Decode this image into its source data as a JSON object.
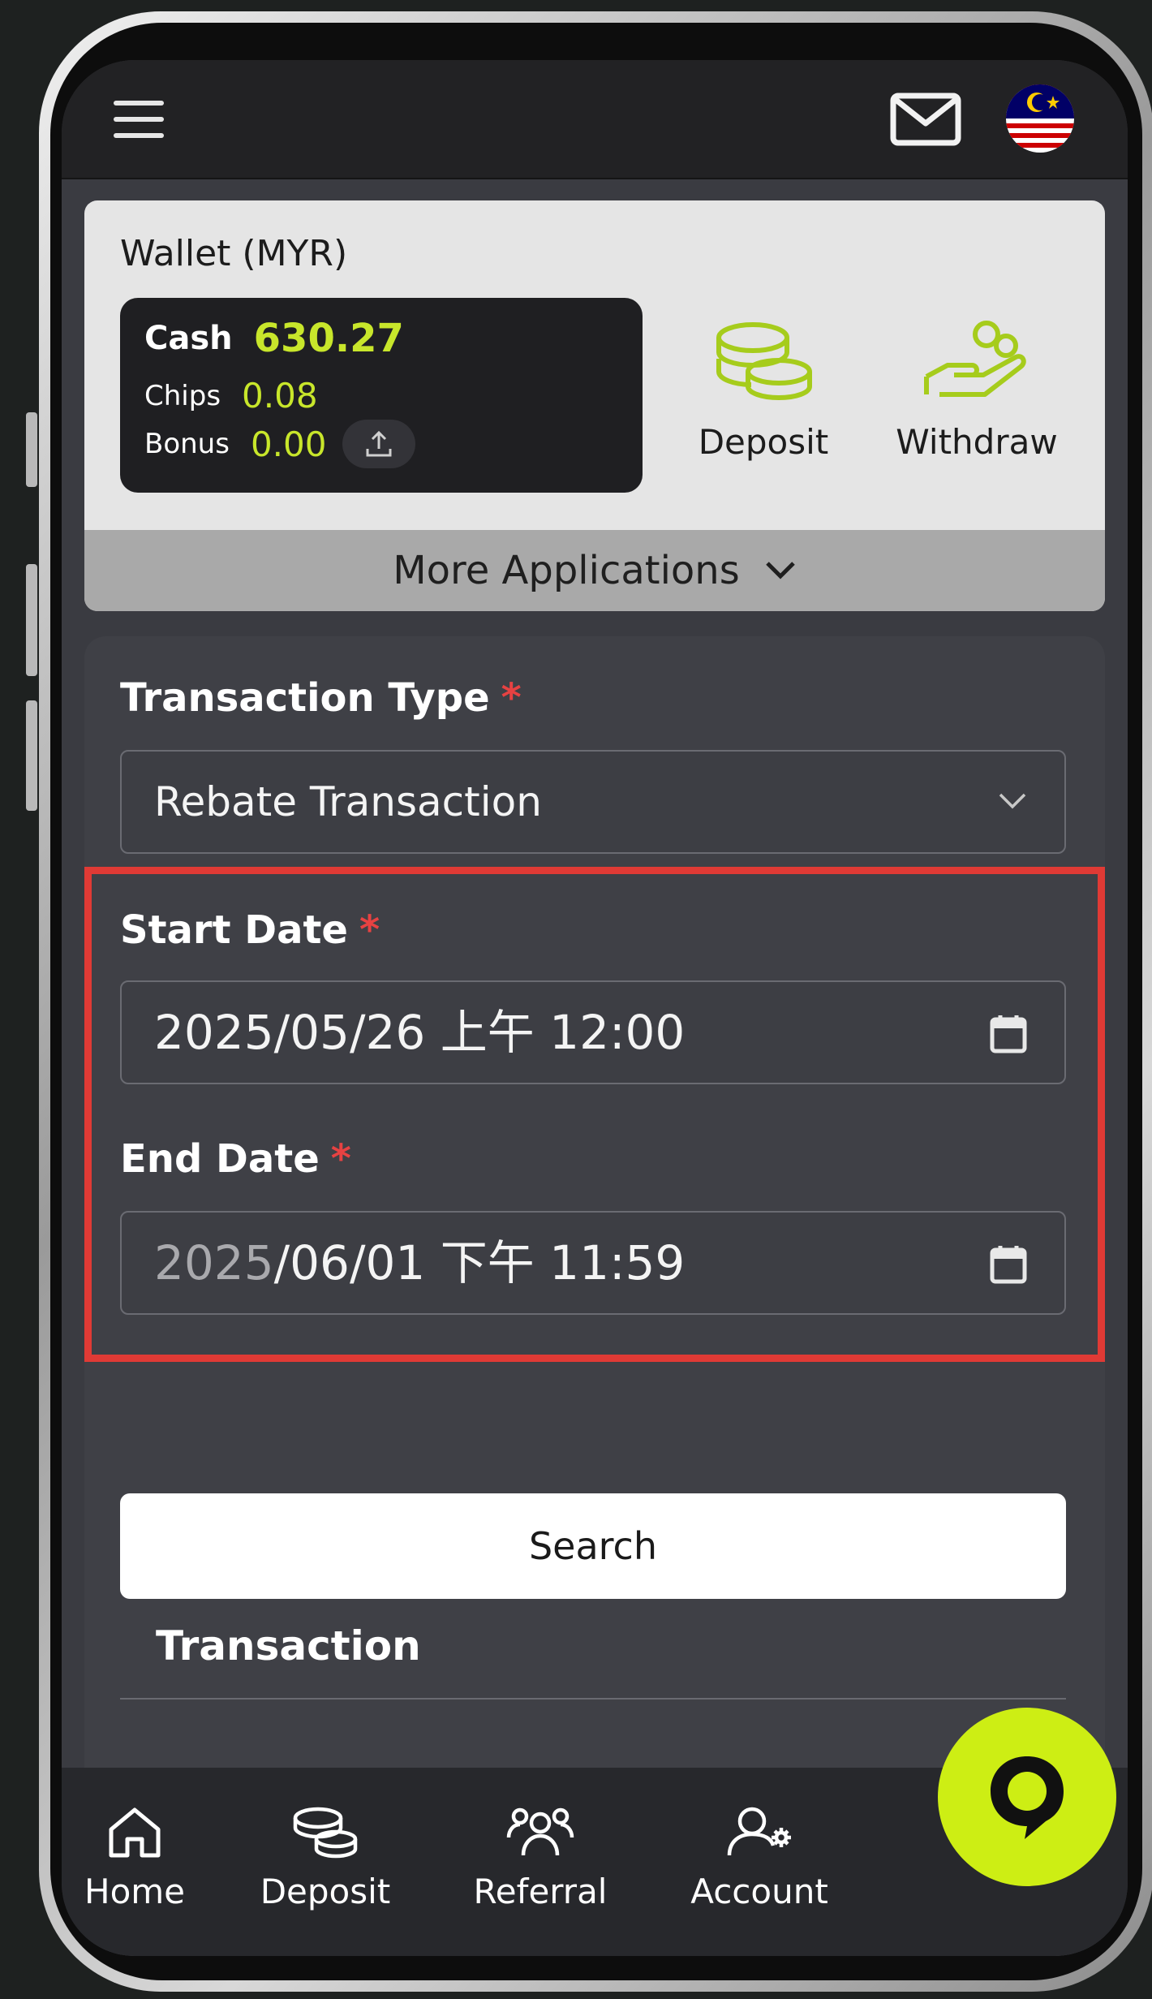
{
  "wallet": {
    "title": "Wallet (MYR)",
    "cash_label": "Cash",
    "cash_value": "630.27",
    "chips_label": "Chips",
    "chips_value": "0.08",
    "bonus_label": "Bonus",
    "bonus_value": "0.00",
    "deposit_label": "Deposit",
    "withdraw_label": "Withdraw",
    "more_apps_label": "More Applications"
  },
  "form": {
    "transaction_type_label": "Transaction Type",
    "transaction_type_value": "Rebate Transaction",
    "required_mark": "*",
    "start_date_label": "Start Date",
    "start_date_value": "2025/05/26 上午 12:00",
    "end_date_label": "End Date",
    "end_date_year": "2025",
    "end_date_rest": "/06/01 下午 11:59",
    "search_label": "Search",
    "section_title": "Transaction"
  },
  "nav": {
    "home": "Home",
    "deposit": "Deposit",
    "referral": "Referral",
    "account": "Account"
  },
  "colors": {
    "accent": "#c8e62b",
    "fab": "#cdee14",
    "highlight": "#e03a35",
    "required": "#e74242"
  },
  "icons": [
    "menu-icon",
    "mail-icon",
    "malaysia-flag-icon",
    "upload-icon",
    "coins-icon",
    "hand-coins-icon",
    "chevron-down-icon",
    "calendar-icon",
    "home-icon",
    "referral-icon",
    "account-icon",
    "chat-icon"
  ]
}
